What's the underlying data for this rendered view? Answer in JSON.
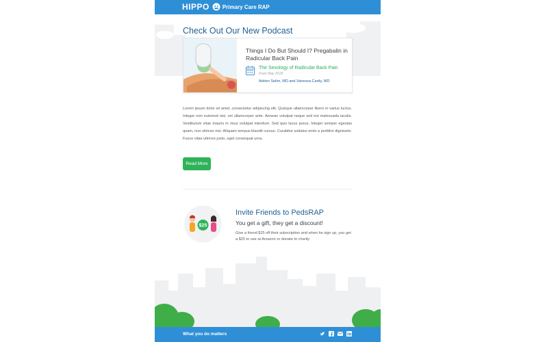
{
  "header": {
    "logo_word": "HIPPO",
    "logo_sub": "Primary Care RAP"
  },
  "podcast": {
    "heading": "Check Out Our New Podcast",
    "episode_title": "Things I Do But Should I? Pregabalin in Radicular Back Pain",
    "subtitle": "The Sexology of Radicular Back Pain",
    "date": "From May 2018",
    "authors": "Adrien Selim, MD and Vanessa Cardy, MD"
  },
  "body": {
    "paragraph": "Lorem ipsum dolor sit amet, consectetur adipiscing elit. Quisque ullamcorper libero in varius luctus. Integer non euismod nisi, vel ullamcorper ante. Aenean volutpat neque sed est malesuada iaculis. Vestibulum vitae mauris in risus volutpat interdum. Sed quis lacus purus. Integer semper egestas quam, non ultrices nisi. Aliquam tempus blandit cursus. Curabitur sodales enim a porttitor dignissim. Fusce vitae ultrices justo, eget consequat urna.",
    "button_label": "Read More"
  },
  "invite": {
    "title": "Invite Friends to PedsRAP",
    "subtitle": "You get a gift, they get a discount!",
    "body": "Give a friend $25 off their subscription and when he sign up, you get a $25 to use at Amazon or donate to charity",
    "badge": "$25"
  },
  "footer": {
    "text": "What you do matters",
    "icons": [
      "twitter-icon",
      "facebook-icon",
      "email-icon",
      "linkedin-icon"
    ]
  },
  "colors": {
    "brand": "#2f8fd6",
    "heading": "#1f5f93",
    "accent_green": "#2fb35a",
    "skyline": "#eff0f1"
  }
}
